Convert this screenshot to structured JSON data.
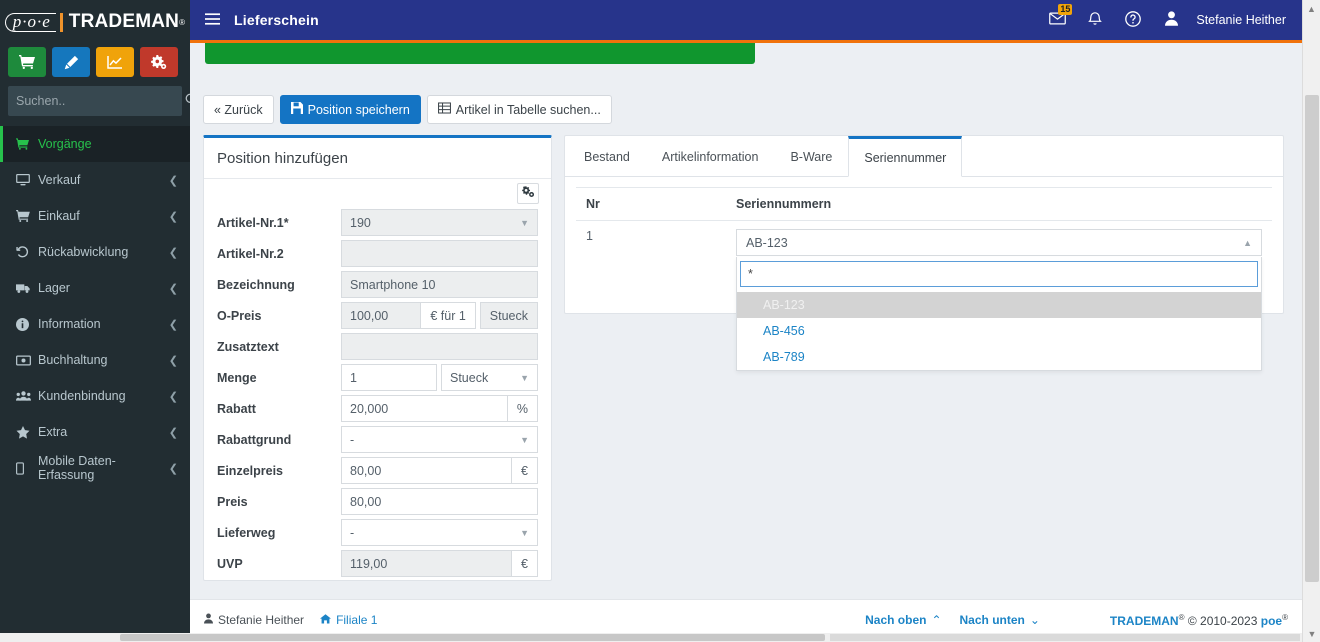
{
  "brand": {
    "poe": "p·o·e",
    "name": "TRADEMAN",
    "reg": "®"
  },
  "sidebar": {
    "quick_buttons": [
      {
        "name": "cart-button",
        "icon": "shopping-cart-icon",
        "color": "#1e8a3c"
      },
      {
        "name": "edit-button",
        "icon": "pencil-icon",
        "color": "#1577bd"
      },
      {
        "name": "stats-button",
        "icon": "chart-line-icon",
        "color": "#f0a30a"
      },
      {
        "name": "settings-button",
        "icon": "gears-icon",
        "color": "#c0392b"
      }
    ],
    "search": {
      "placeholder": "Suchen..",
      "value": ""
    },
    "items": [
      {
        "label": "Vorgänge",
        "icon": "cart-icon",
        "active": true,
        "caret": ""
      },
      {
        "label": "Verkauf",
        "icon": "desktop-icon",
        "active": false,
        "caret": "❮"
      },
      {
        "label": "Einkauf",
        "icon": "cart-icon",
        "active": false,
        "caret": "❮"
      },
      {
        "label": "Rückabwicklung",
        "icon": "undo-icon",
        "active": false,
        "caret": "❮"
      },
      {
        "label": "Lager",
        "icon": "truck-icon",
        "active": false,
        "caret": "❮"
      },
      {
        "label": "Information",
        "icon": "info-circle-icon",
        "active": false,
        "caret": "❮"
      },
      {
        "label": "Buchhaltung",
        "icon": "money-icon",
        "active": false,
        "caret": "❮"
      },
      {
        "label": "Kundenbindung",
        "icon": "users-icon",
        "active": false,
        "caret": "❮"
      },
      {
        "label": "Extra",
        "icon": "star-icon",
        "active": false,
        "caret": "❮"
      },
      {
        "label": "Mobile Daten-Erfassung",
        "icon": "mobile-icon",
        "active": false,
        "caret": "❮"
      }
    ]
  },
  "header": {
    "title": "Lieferschein",
    "mail_badge": "15",
    "user": "Stefanie Heither",
    "colors": {
      "bar": "#27348b",
      "accent": "#f0720c"
    }
  },
  "toolbar": {
    "back_label": "« Zurück",
    "save_label": "Position speichern",
    "search_table_label": "Artikel in Tabelle suchen..."
  },
  "form": {
    "title": "Position hinzufügen",
    "rows": [
      {
        "label": "Artikel-Nr.1*",
        "type": "select",
        "value": "190",
        "addon": "",
        "disabled": true
      },
      {
        "label": "Artikel-Nr.2",
        "type": "text",
        "value": "",
        "addon": "",
        "disabled": true
      },
      {
        "label": "Bezeichnung",
        "type": "text",
        "value": "Smartphone 10",
        "addon": "",
        "disabled": true
      },
      {
        "label": "O-Preis",
        "type": "price",
        "value": "100,00",
        "addon": "€ für 1",
        "addon2": "Stueck",
        "disabled": true
      },
      {
        "label": "Zusatztext",
        "type": "text",
        "value": "",
        "addon": "",
        "disabled": true
      },
      {
        "label": "Menge",
        "type": "qty",
        "value": "1",
        "addon": "Stueck",
        "disabled": false
      },
      {
        "label": "Rabatt",
        "type": "text",
        "value": "20,000",
        "addon": "%",
        "disabled": false
      },
      {
        "label": "Rabattgrund",
        "type": "select",
        "value": "-",
        "addon": "",
        "disabled": false
      },
      {
        "label": "Einzelpreis",
        "type": "text",
        "value": "80,00",
        "addon": "€",
        "disabled": false
      },
      {
        "label": "Preis",
        "type": "text",
        "value": "80,00",
        "addon": "",
        "disabled": false
      },
      {
        "label": "Lieferweg",
        "type": "select",
        "value": "-",
        "addon": "",
        "disabled": false
      },
      {
        "label": "UVP",
        "type": "text",
        "value": "119,00",
        "addon": "€",
        "disabled": true
      }
    ]
  },
  "right_panel": {
    "tabs": [
      {
        "label": "Bestand",
        "active": false
      },
      {
        "label": "Artikelinformation",
        "active": false
      },
      {
        "label": "B-Ware",
        "active": false
      },
      {
        "label": "Seriennummer",
        "active": true
      }
    ],
    "table": {
      "headers": [
        "Nr",
        "Seriennummern"
      ],
      "rows": [
        {
          "nr": "1",
          "serial": "AB-123"
        }
      ]
    },
    "dropdown": {
      "selected": "AB-123",
      "search_value": "*",
      "open": true,
      "options": [
        {
          "label": "AB-123",
          "highlighted": true
        },
        {
          "label": "AB-456",
          "highlighted": false
        },
        {
          "label": "AB-789",
          "highlighted": false
        }
      ]
    }
  },
  "footer": {
    "user": "Stefanie Heither",
    "branch": "Filiale 1",
    "up_label": "Nach oben",
    "up_caret": "⌃",
    "down_label": "Nach unten",
    "down_caret": "⌄",
    "copyright_brand": "TRADEMAN",
    "copyright_text": "© 2010-2023",
    "copyright_poe": "poe"
  }
}
